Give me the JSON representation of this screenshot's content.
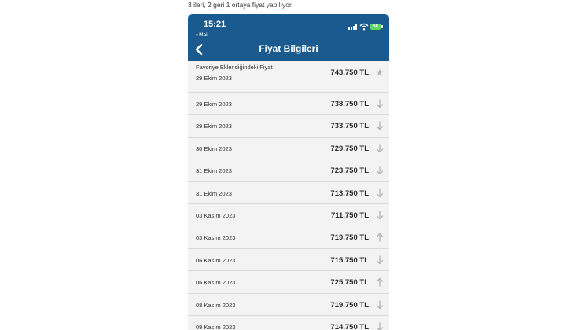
{
  "caption": "3  ileri, 2 geri 1 ortaya fiyat yapılıyor",
  "status_bar": {
    "time": "15:21",
    "back_app": "◂ Mail",
    "battery": "68"
  },
  "header": {
    "title": "Fiyat Bilgileri"
  },
  "favorite": {
    "label": "Favoriye Eklendiğindeki Fiyat",
    "date": "29 Ekim 2023",
    "price": "743.750 TL",
    "icon": "star-icon"
  },
  "rows": [
    {
      "date": "29 Ekim 2023",
      "price": "738.750 TL",
      "trend": "down"
    },
    {
      "date": "29 Ekim 2023",
      "price": "733.750 TL",
      "trend": "down"
    },
    {
      "date": "30 Ekim 2023",
      "price": "729.750 TL",
      "trend": "down"
    },
    {
      "date": "31 Ekim 2023",
      "price": "723.750 TL",
      "trend": "down"
    },
    {
      "date": "31 Ekim 2023",
      "price": "713.750 TL",
      "trend": "down"
    },
    {
      "date": "03 Kasım 2023",
      "price": "711.750 TL",
      "trend": "down"
    },
    {
      "date": "03 Kasım 2023",
      "price": "719.750 TL",
      "trend": "up"
    },
    {
      "date": "06 Kasım 2023",
      "price": "715.750 TL",
      "trend": "down"
    },
    {
      "date": "06 Kasım 2023",
      "price": "725.750 TL",
      "trend": "up"
    },
    {
      "date": "08 Kasım 2023",
      "price": "719.750 TL",
      "trend": "down"
    },
    {
      "date": "09 Kasım 2023",
      "price": "714.750 TL",
      "trend": "down"
    }
  ],
  "colors": {
    "header_bg": "#1b5a8e",
    "arrow": "#b4b4b4",
    "battery": "#5fd26a"
  }
}
